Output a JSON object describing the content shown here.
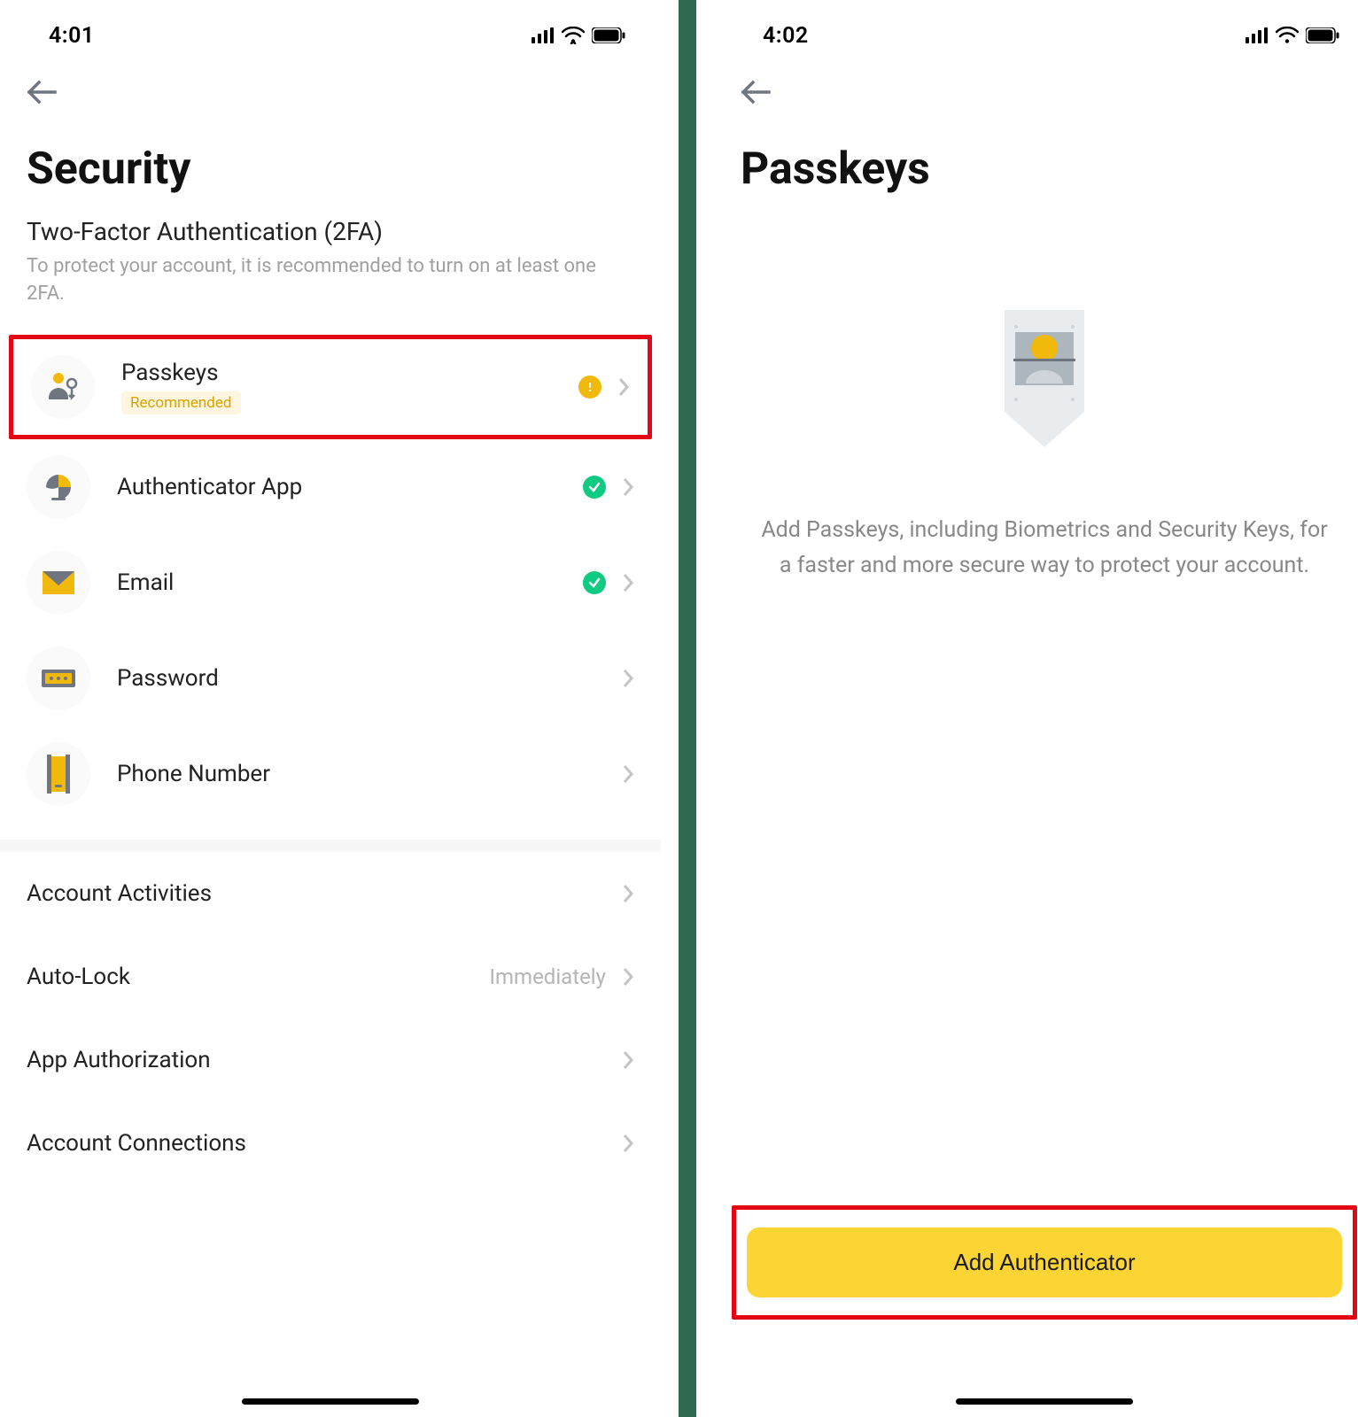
{
  "screen1": {
    "statusTime": "4:01",
    "title": "Security",
    "tfa": {
      "heading": "Two-Factor Authentication (2FA)",
      "sub": "To protect your account, it is recommended to turn on at least one 2FA."
    },
    "items": [
      {
        "label": "Passkeys",
        "badge": "Recommended",
        "status": "warn"
      },
      {
        "label": "Authenticator App",
        "status": "ok"
      },
      {
        "label": "Email",
        "status": "ok"
      },
      {
        "label": "Password"
      },
      {
        "label": "Phone Number"
      }
    ],
    "more": [
      {
        "label": "Account Activities"
      },
      {
        "label": "Auto-Lock",
        "value": "Immediately"
      },
      {
        "label": "App Authorization"
      },
      {
        "label": "Account Connections"
      }
    ]
  },
  "screen2": {
    "statusTime": "4:02",
    "title": "Passkeys",
    "emptyText": "Add Passkeys, including Biometrics and Security Keys, for a faster and more secure way to protect your account.",
    "cta": "Add Authenticator"
  }
}
